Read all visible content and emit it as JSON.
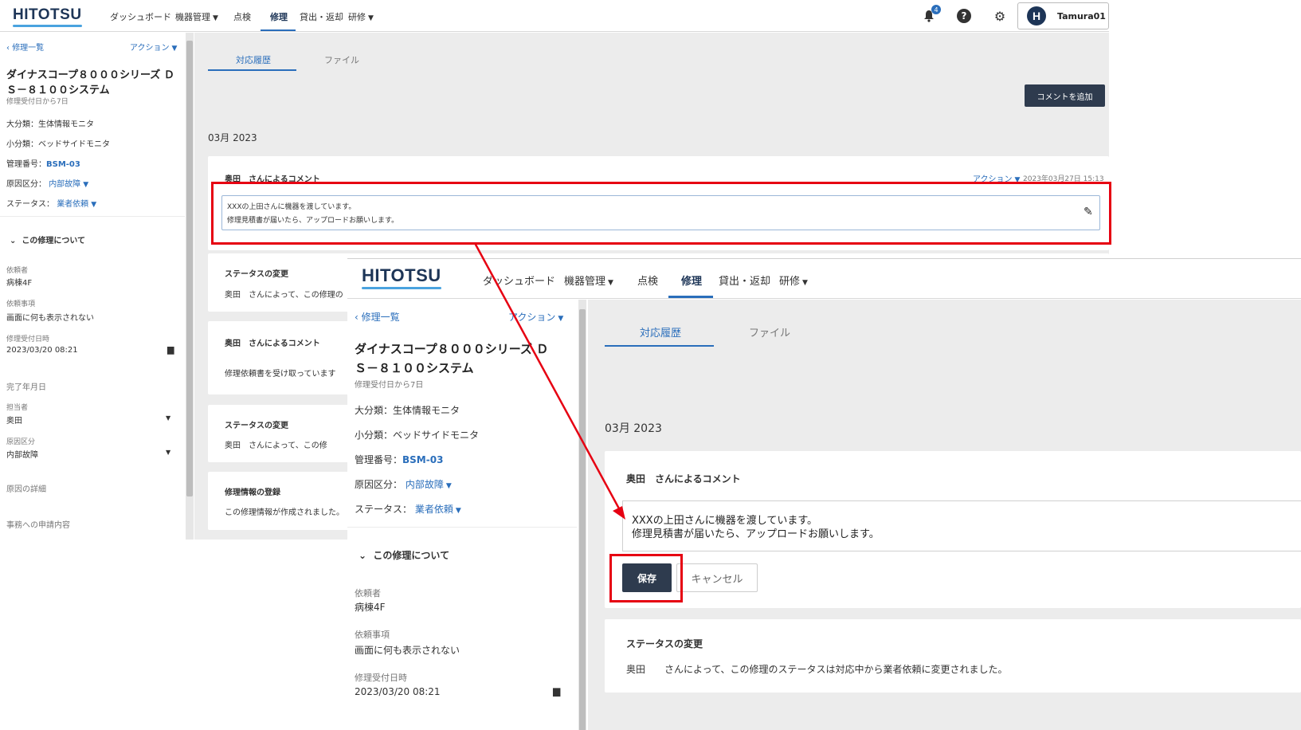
{
  "nav": {
    "logo": "HITOTSU",
    "items": [
      "ダッシュボード",
      "機器管理",
      "点検",
      "修理",
      "貸出・返却",
      "研修"
    ],
    "notification_count": "4",
    "user_initial": "H",
    "user_name": "Tamura01"
  },
  "sidebar": {
    "back_link": "修理一覧",
    "action": "アクション",
    "title_line1": "ダイナスコープ８０００シリーズ Ｄ",
    "title_line2": "Ｓ－８１００システム",
    "elapsed": "修理受付日から7日",
    "major_category": "大分類：生体情報モニタ",
    "minor_category": "小分類：ベッドサイドモニタ",
    "asset_label": "管理番号：",
    "asset_number": "BSM-03",
    "cause_label": "原因区分：",
    "cause_value": "内部故障",
    "status_label": "ステータス：",
    "status_value": "業者依頼",
    "section_about": "この修理について",
    "requester_label": "依頼者",
    "requester_value": "病棟4F",
    "request_label": "依頼事項",
    "request_value": "画面に何も表示されない",
    "received_label": "修理受付日時",
    "received_value": "2023/03/20 08:21",
    "completed_label": "完了年月日",
    "assignee_label": "担当者",
    "assignee_value": "奥田",
    "cause_field_label": "原因区分",
    "cause_field_value": "内部故障",
    "cause_detail_label": "原因の詳細",
    "office_request_label": "事務への申請内容"
  },
  "main": {
    "tab_history": "対応履歴",
    "tab_files": "ファイル",
    "add_comment": "コメントを追加",
    "month_heading": "03月 2023",
    "comment_card": {
      "author": "奥田",
      "title_suffix": "さんによるコメント",
      "action": "アクション",
      "timestamp": "2023年03月27日 15:13",
      "line1": "XXXの上田さんに機器を渡しています。",
      "line2": "修理見積書が届いたら、アップロードお願いします。"
    },
    "status_card_1": {
      "title": "ステータスの変更",
      "author": "奥田",
      "text_cut": "さんによって、この修理の",
      "text_full": "さんによって、この修理のステータスは対応中から業者依頼に変更されました。"
    },
    "comment_card_2": {
      "author": "奥田",
      "title_suffix": "さんによるコメント",
      "text": "修理依頼書を受け取っています"
    },
    "status_card_2": {
      "title": "ステータスの変更",
      "author": "奥田",
      "text_cut": "さんによって、この修"
    },
    "registration_card": {
      "title": "修理情報の登録",
      "text": "この修理情報が作成されました。"
    },
    "save_button": "保存",
    "cancel_button": "キャンセル"
  },
  "colors": {
    "brand": "#1d3557",
    "accent": "#2a6ebb",
    "annotation": "#e60012"
  }
}
